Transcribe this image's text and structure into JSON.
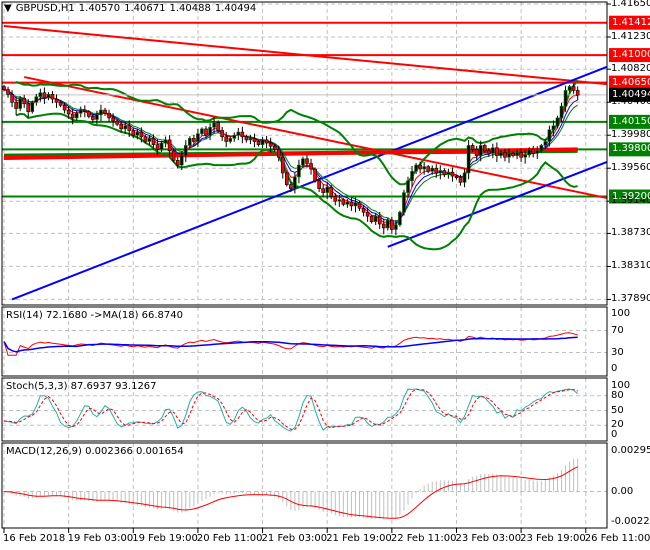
{
  "header": {
    "menu_icon": "triangle-down-icon",
    "symbol": "GBPUSD,H1",
    "open": "1.40570",
    "high": "1.40671",
    "low": "1.40488",
    "close": "1.40494"
  },
  "indicators": {
    "rsi_label": "RSI(14) 72.1680  ->MA(18) 66.8740",
    "stoch_label": "Stoch(5,3,3) 87.6937 93.1267",
    "macd_label": "MACD(12,26,9) 0.002366 0.001654"
  },
  "colors": {
    "bull": "#008000",
    "bear": "#ff0000",
    "support": "#008000",
    "resistance": "#ff0000",
    "trend_blue": "#0000ff",
    "stoch_main": "#20b2aa",
    "macd_hist": "#c0c0c0"
  },
  "chart_data": {
    "type": "candlestick",
    "title": "GBPUSD,H1",
    "ylim": [
      1.3789,
      1.4165
    ],
    "y_ticks": [
      "1.41650",
      "1.41230",
      "1.40820",
      "1.40400",
      "1.39980",
      "1.39560",
      "1.39140",
      "1.38730",
      "1.38310",
      "1.37890"
    ],
    "x_ticks": [
      {
        "bar": 0,
        "label": "16 Feb 2018"
      },
      {
        "bar": 16,
        "label": "19 Feb 03:00"
      },
      {
        "bar": 32,
        "label": "19 Feb 19:00"
      },
      {
        "bar": 48,
        "label": "20 Feb 11:00"
      },
      {
        "bar": 64,
        "label": "21 Feb 03:00"
      },
      {
        "bar": 80,
        "label": "21 Feb 19:00"
      },
      {
        "bar": 96,
        "label": "22 Feb 11:00"
      },
      {
        "bar": 112,
        "label": "23 Feb 03:00"
      },
      {
        "bar": 128,
        "label": "23 Feb 19:00"
      },
      {
        "bar": 144,
        "label": "26 Feb 11:00"
      }
    ],
    "closes": [
      1.4056,
      1.405,
      1.404,
      1.4032,
      1.4045,
      1.4038,
      1.4028,
      1.404,
      1.4047,
      1.4052,
      1.4046,
      1.405,
      1.4044,
      1.404,
      1.4036,
      1.403,
      1.4025,
      1.402,
      1.4026,
      1.403,
      1.4028,
      1.4022,
      1.4018,
      1.4024,
      1.403,
      1.4026,
      1.402,
      1.4016,
      1.4012,
      1.4006,
      1.401,
      1.4004,
      1.3998,
      1.4002,
      1.3996,
      1.399,
      1.3994,
      1.3986,
      1.398,
      1.3988,
      1.3992,
      1.3978,
      1.3966,
      1.396,
      1.3972,
      1.3985,
      1.3994,
      1.399,
      1.4,
      1.4006,
      1.3998,
      1.4008,
      1.4014,
      1.4004,
      1.3996,
      1.399,
      1.3994,
      1.3998,
      1.4002,
      1.3996,
      1.3992,
      1.3994,
      1.399,
      1.3986,
      1.3992,
      1.3988,
      1.3984,
      1.398,
      1.397,
      1.395,
      1.3935,
      1.393,
      1.3945,
      1.396,
      1.3968,
      1.3962,
      1.3955,
      1.394,
      1.393,
      1.3925,
      1.3932,
      1.392,
      1.3914,
      1.3916,
      1.391,
      1.3913,
      1.3908,
      1.3912,
      1.3905,
      1.39,
      1.3895,
      1.3888,
      1.3895,
      1.3885,
      1.388,
      1.389,
      1.3878,
      1.3884,
      1.39,
      1.3925,
      1.394,
      1.3952,
      1.396,
      1.3955,
      1.3958,
      1.3952,
      1.3956,
      1.395,
      1.3953,
      1.3948,
      1.3951,
      1.3946,
      1.3944,
      1.3938,
      1.395,
      1.3985,
      1.398,
      1.3972,
      1.3985,
      1.3978,
      1.3975,
      1.3982,
      1.3972,
      1.3976,
      1.397,
      1.3975,
      1.3972,
      1.3976,
      1.397,
      1.3973,
      1.398,
      1.3975,
      1.3978,
      1.3985,
      1.399,
      1.4005,
      1.401,
      1.402,
      1.4035,
      1.4055,
      1.406,
      1.4055,
      1.4049
    ],
    "levels": [
      {
        "price": 1.41412,
        "label": "1.41412",
        "kind": "resistance"
      },
      {
        "price": 1.41,
        "label": "1.41000",
        "kind": "resistance"
      },
      {
        "price": 1.4065,
        "label": "1.40650",
        "kind": "resistance"
      },
      {
        "price": 1.4015,
        "label": "1.40150",
        "kind": "support"
      },
      {
        "price": 1.398,
        "label": "1.39800",
        "kind": "support"
      },
      {
        "price": 1.392,
        "label": "1.39200",
        "kind": "support"
      }
    ],
    "current_price": {
      "price": 1.40494,
      "label": "1.40494"
    },
    "trendlines": [
      {
        "from": [
          0,
          1.4137
        ],
        "to": [
          150,
          1.4063
        ],
        "color": "#ff0000"
      },
      {
        "from": [
          5,
          1.4072
        ],
        "to": [
          150,
          1.3918
        ],
        "color": "#ff0000"
      },
      {
        "from": [
          2,
          1.3789
        ],
        "to": [
          150,
          1.4085
        ],
        "color": "#0000ff"
      },
      {
        "from": [
          95,
          1.3856
        ],
        "to": [
          150,
          1.3964
        ],
        "color": "#0000ff"
      },
      {
        "from": [
          0,
          1.3972
        ],
        "to": [
          142,
          1.3978
        ],
        "color": "#008000"
      },
      {
        "from": [
          0,
          1.3969
        ],
        "to": [
          142,
          1.398
        ],
        "color": "#ff0000"
      }
    ],
    "rsi": {
      "period": 14,
      "ma": 18,
      "ticks": [
        "100",
        "70",
        "30",
        "0"
      ],
      "value": 72.168,
      "ma_value": 66.874
    },
    "stoch": {
      "k": 5,
      "d": 3,
      "slow": 3,
      "ticks": [
        "100",
        "80",
        "50",
        "20",
        "0"
      ],
      "main": 87.6937,
      "signal": 93.1267
    },
    "macd": {
      "fast": 12,
      "slow": 26,
      "signal": 9,
      "ticks": [
        "0.002953",
        "0.00",
        "-0.002216"
      ],
      "range": [
        -0.002216,
        0.002953
      ],
      "main": 0.002366,
      "signal_value": 0.001654
    }
  }
}
